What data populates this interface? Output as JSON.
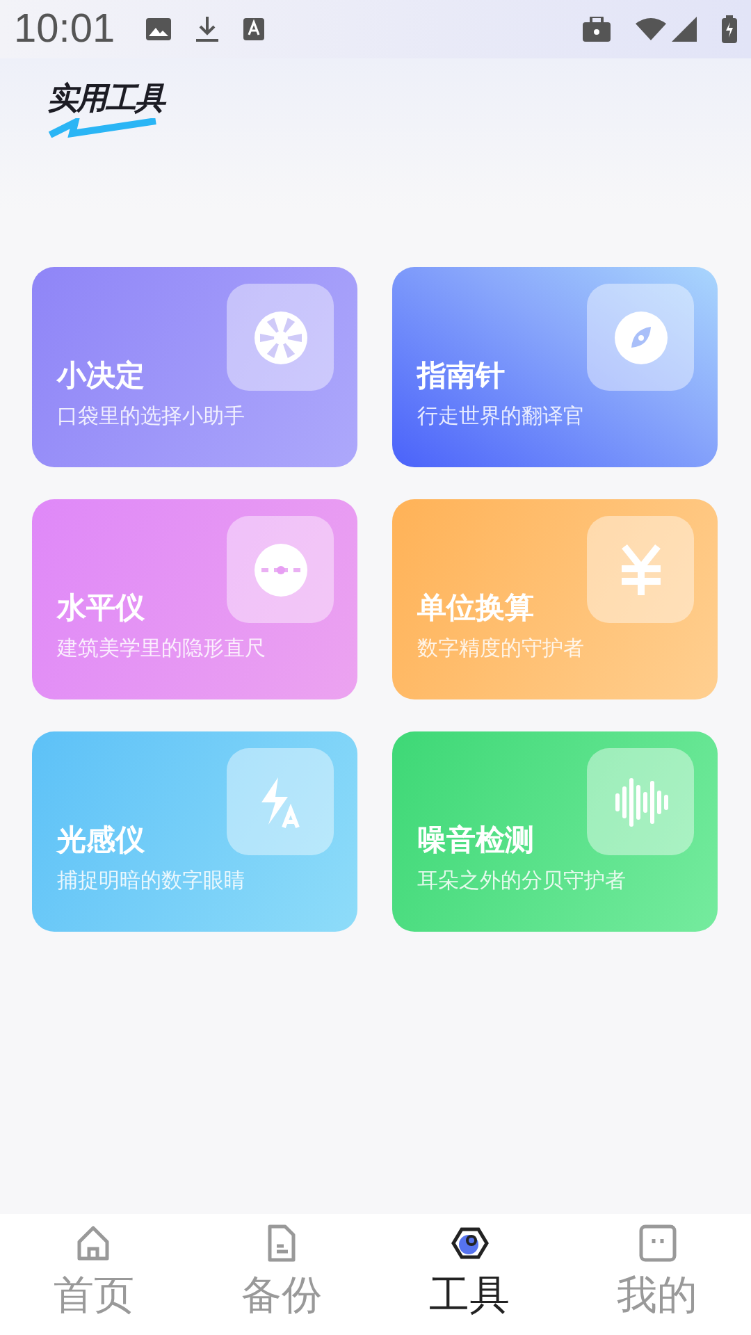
{
  "status_bar": {
    "time": "10:01"
  },
  "header": {
    "title": "实用工具"
  },
  "tools": [
    {
      "kind": "wheel",
      "title": "小决定",
      "subtitle": "口袋里的选择小助手"
    },
    {
      "kind": "compass",
      "title": "指南针",
      "subtitle": "行走世界的翻译官"
    },
    {
      "kind": "level",
      "title": "水平仪",
      "subtitle": "建筑美学里的隐形直尺"
    },
    {
      "kind": "currency",
      "title": "单位换算",
      "subtitle": "数字精度的守护者"
    },
    {
      "kind": "light",
      "title": "光感仪",
      "subtitle": "捕捉明暗的数字眼睛"
    },
    {
      "kind": "sound",
      "title": "噪音检测",
      "subtitle": "耳朵之外的分贝守护者"
    }
  ],
  "tab_bar": [
    {
      "kind": "home",
      "label": "首页",
      "selected": false
    },
    {
      "kind": "doc",
      "label": "备份",
      "selected": false
    },
    {
      "kind": "tools",
      "label": "工具",
      "selected": true
    },
    {
      "kind": "me",
      "label": "我的",
      "selected": false
    }
  ]
}
